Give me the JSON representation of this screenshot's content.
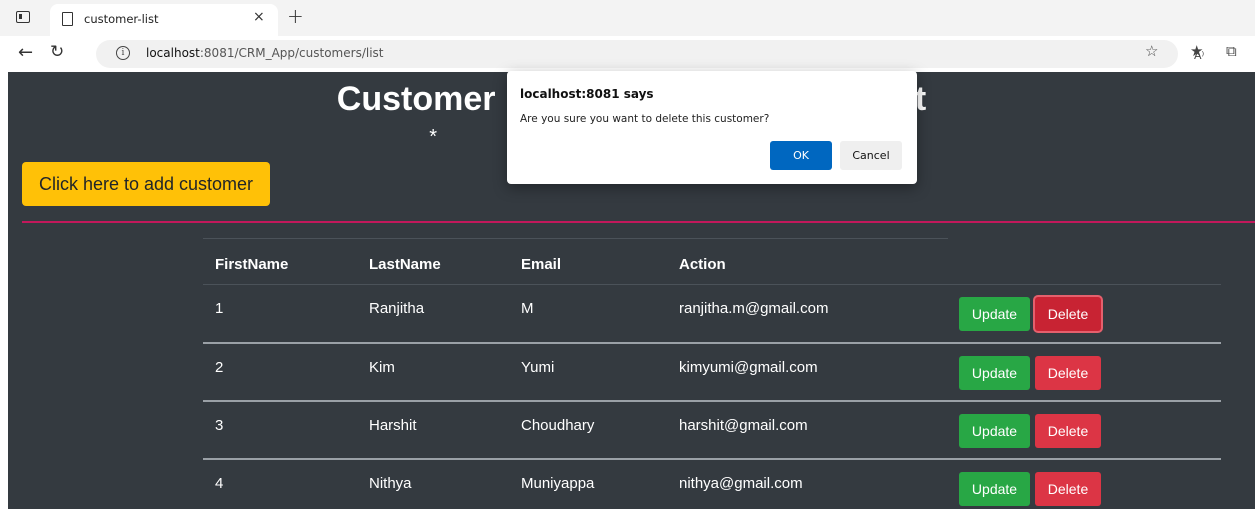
{
  "browser": {
    "tab_title": "customer-list",
    "tab_close": "×",
    "new_tab": "+",
    "url_host": "localhost",
    "url_path": ":8081/CRM_App/customers/list",
    "read_aloud_label": "A⁾"
  },
  "page": {
    "title": "Customer Relationship Management",
    "subtitle": "*                                                                      *",
    "add_button": "Click here to add customer"
  },
  "table": {
    "headers": [
      "FirstName",
      "LastName",
      "Email",
      "Action"
    ],
    "rows": [
      {
        "id": "1",
        "first": "Ranjitha",
        "last": "M",
        "email": "ranjitha.m@gmail.com"
      },
      {
        "id": "2",
        "first": "Kim",
        "last": "Yumi",
        "email": "kimyumi@gmail.com"
      },
      {
        "id": "3",
        "first": "Harshit",
        "last": "Choudhary",
        "email": "harshit@gmail.com"
      },
      {
        "id": "4",
        "first": "Nithya",
        "last": "Muniyappa",
        "email": "nithya@gmail.com"
      }
    ],
    "update_label": "Update",
    "delete_label": "Delete"
  },
  "dialog": {
    "title": "localhost:8081 says",
    "message": "Are you sure you want to delete this customer?",
    "ok_label": "OK",
    "cancel_label": "Cancel"
  },
  "colors": {
    "page_bg": "#343a40",
    "add_button": "#ffc107",
    "update_button": "#28a745",
    "delete_button": "#dc3545",
    "divider": "#c2185b",
    "dialog_ok": "#0067c0"
  }
}
